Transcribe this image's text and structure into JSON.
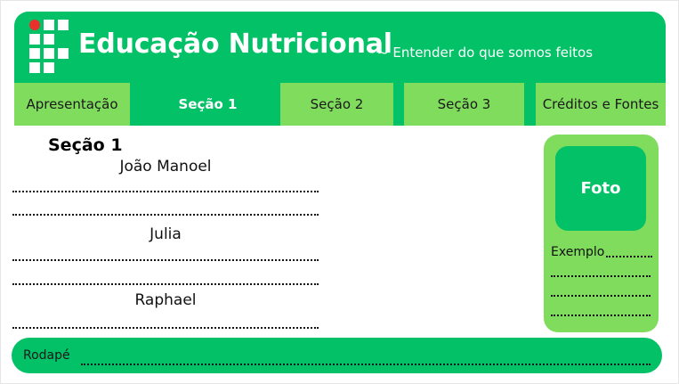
{
  "header": {
    "title": "Educação Nutricional",
    "subtitle": "~ Entender do que somos feitos",
    "colors": {
      "primary": "#03c167",
      "secondary": "#80dc5c",
      "logo_dot": "#e8312d"
    },
    "logo_icon": "institution-grid-logo-icon"
  },
  "nav": {
    "items": [
      {
        "label": "Apresentação",
        "active": false
      },
      {
        "label": "Seção 1",
        "active": true
      },
      {
        "label": "Seção 2",
        "active": false
      },
      {
        "label": "Seção 3",
        "active": false
      },
      {
        "label": "Créditos e Fontes",
        "active": false
      }
    ]
  },
  "main": {
    "section_title": "Seção 1",
    "names": [
      "João Manoel",
      "Julia",
      "Raphael"
    ]
  },
  "aside": {
    "photo_label": "Foto",
    "example_text": "Exemplo"
  },
  "footer": {
    "text": "Rodapé"
  }
}
